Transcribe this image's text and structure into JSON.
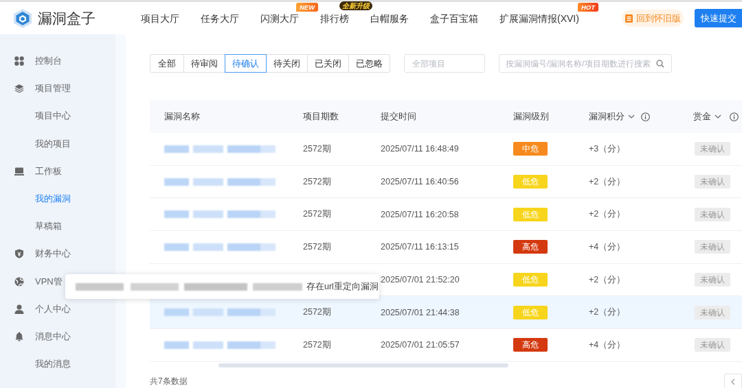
{
  "header": {
    "logo": "漏洞盒子",
    "nav": [
      {
        "label": "项目大厅"
      },
      {
        "label": "任务大厅"
      },
      {
        "label": "闪测大厅",
        "badge": {
          "kind": "new",
          "text": "NEW"
        }
      },
      {
        "label": "排行榜",
        "badge": {
          "kind": "upgrade",
          "text": "全新升级"
        }
      },
      {
        "label": "白帽服务"
      },
      {
        "label": "盒子百宝箱"
      },
      {
        "label": "扩展漏洞情报(XVI)",
        "badge": {
          "kind": "hot",
          "text": "HOT"
        }
      }
    ],
    "classic_link": "回到怀旧版",
    "submit_button": "快速提交"
  },
  "sidebar": {
    "items": [
      {
        "label": "控制台",
        "selected": false
      },
      {
        "label": "项目管理",
        "selected": false,
        "children": [
          {
            "label": "项目中心",
            "selected": false
          },
          {
            "label": "我的项目",
            "selected": false
          }
        ]
      },
      {
        "label": "工作板",
        "selected": false,
        "children": [
          {
            "label": "我的漏洞",
            "selected": true
          },
          {
            "label": "草稿箱",
            "selected": false
          }
        ]
      },
      {
        "label": "财务中心",
        "selected": false
      },
      {
        "label": "VPN管",
        "selected": false
      },
      {
        "label": "个人中心",
        "selected": false
      },
      {
        "label": "消息中心",
        "selected": false,
        "children": [
          {
            "label": "我的消息",
            "selected": false
          }
        ]
      }
    ]
  },
  "filters": {
    "status_tabs": [
      {
        "label": "全部",
        "selected": false
      },
      {
        "label": "待审阅",
        "selected": false
      },
      {
        "label": "待确认",
        "selected": true
      },
      {
        "label": "待关闭",
        "selected": false
      },
      {
        "label": "已关闭",
        "selected": false
      },
      {
        "label": "已忽略",
        "selected": false
      }
    ],
    "project_select": {
      "placeholder": "全部项目"
    },
    "search": {
      "placeholder": "按漏洞编号/漏洞名称/项目期数进行搜索"
    }
  },
  "table": {
    "columns": [
      {
        "label": "漏洞名称",
        "sortable": false,
        "info": false
      },
      {
        "label": "项目期数",
        "sortable": false,
        "info": false
      },
      {
        "label": "提交时间",
        "sortable": false,
        "info": false
      },
      {
        "label": "漏洞级别",
        "sortable": false,
        "info": false
      },
      {
        "label": "漏洞积分",
        "sortable": true,
        "info": true
      },
      {
        "label": "赏金",
        "sortable": true,
        "info": true
      }
    ],
    "rows": [
      {
        "name_blurred": true,
        "period": "2572期",
        "submitted": "2025/07/11 16:48:49",
        "severity": {
          "label": "中危",
          "color": "#f78a1e"
        },
        "score": "+3（分）",
        "bounty": "未确认",
        "hovered": false
      },
      {
        "name_blurred": true,
        "period": "2572期",
        "submitted": "2025/07/11 16:40:56",
        "severity": {
          "label": "低危",
          "color": "#f7d51c"
        },
        "score": "+2（分）",
        "bounty": "未确认",
        "hovered": false
      },
      {
        "name_blurred": true,
        "period": "2572期",
        "submitted": "2025/07/11 16:20:58",
        "severity": {
          "label": "低危",
          "color": "#f7d51c"
        },
        "score": "+2（分）",
        "bounty": "未确认",
        "hovered": false
      },
      {
        "name_blurred": true,
        "period": "2572期",
        "submitted": "2025/07/11 16:13:15",
        "severity": {
          "label": "高危",
          "color": "#d4390f"
        },
        "score": "+4（分）",
        "bounty": "未确认",
        "hovered": false
      },
      {
        "name_blurred": false,
        "submitted": "2025/07/01 21:52:20",
        "severity": {
          "label": "低危",
          "color": "#f7d51c"
        },
        "score": "+2（分）",
        "bounty": "未确认",
        "hovered": false
      },
      {
        "name_blurred": true,
        "period": "2572期",
        "submitted": "2025/07/01 21:44:38",
        "severity": {
          "label": "低危",
          "color": "#f7d51c"
        },
        "score": "+2（分）",
        "bounty": "未确认",
        "hovered": true,
        "tooltip": {
          "redacted": true,
          "text": "存在url重定向漏洞"
        }
      },
      {
        "name_blurred": true,
        "period": "2572期",
        "submitted": "2025/07/01 21:05:57",
        "severity": {
          "label": "高危",
          "color": "#d4390f"
        },
        "score": "+4（分）",
        "bounty": "未确认",
        "hovered": false
      }
    ]
  },
  "footer": {
    "total": "共7条数据"
  }
}
